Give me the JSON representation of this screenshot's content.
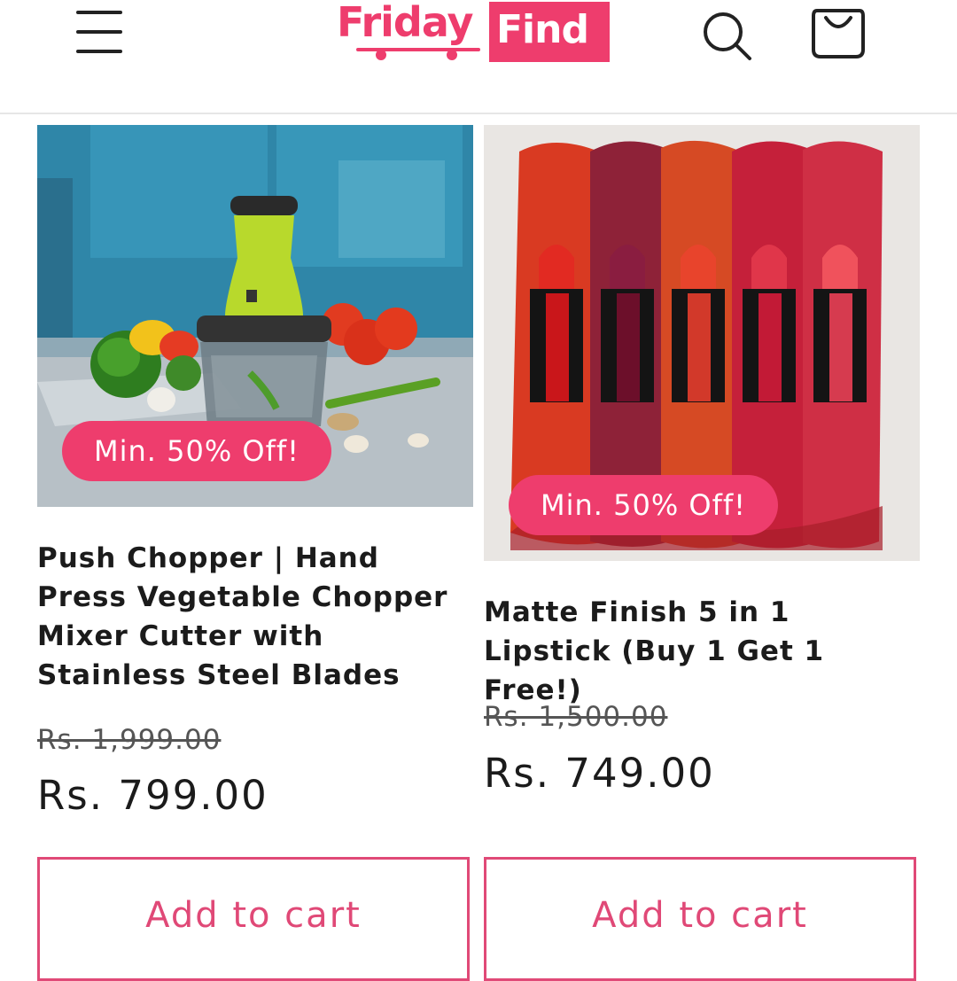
{
  "header": {
    "logo_text_1": "Friday",
    "logo_text_2": "Find",
    "menu_icon": "hamburger-menu-icon",
    "search_icon": "search-icon",
    "cart_icon": "shopping-bag-icon"
  },
  "colors": {
    "brand": "#ee3d6d",
    "button_border": "#e04977",
    "text": "#1b1b1b"
  },
  "products": [
    {
      "badge": "Min. 50% Off!",
      "title": "Push Chopper | Hand Press Vegetable Chopper Mixer Cutter with Stainless Steel Blades",
      "compare_price": "Rs. 1,999.00",
      "price": "Rs. 799.00",
      "cta": "Add to cart"
    },
    {
      "badge": "Min. 50% Off!",
      "title": "Matte Finish 5 in 1 Lipstick (Buy 1 Get 1 Free!)",
      "compare_price": "Rs. 1,500.00",
      "price": "Rs. 749.00",
      "cta": "Add to cart"
    }
  ]
}
